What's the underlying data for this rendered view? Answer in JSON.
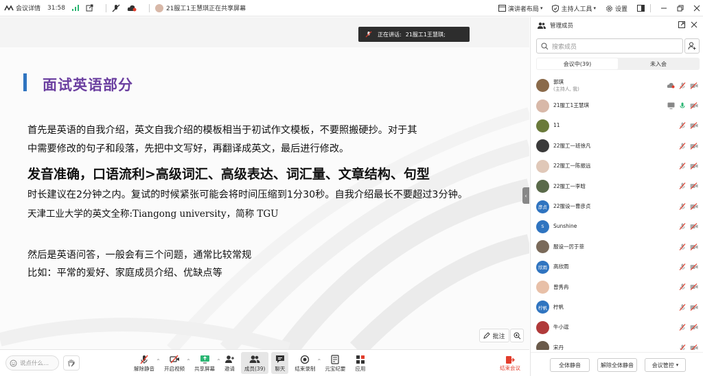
{
  "topbar": {
    "meeting_info": "会议详情",
    "duration": "31:58",
    "share_notice": "21服工1王慧琪正在共享屏幕",
    "layout_label": "演讲者布局",
    "host_tools": "主持人工具",
    "settings": "设置"
  },
  "speaker": {
    "label": "正在讲话:",
    "name": "21服工1王慧琪;"
  },
  "slide": {
    "title": "面试英语部分",
    "lines": [
      "首先是英语的自我介绍，英文自我介绍的模板相当于初试作文模板，不要照搬硬抄。对于其",
      "中需要修改的句子和段落，先把中文写好，再翻译成英文，最后进行修改。",
      "发音准确，口语流利>高级词汇、高级表达、词汇量、文章结构、句型",
      "时长建议在2分钟之内。复试的时候紧张可能会将时间压缩到1分30秒。自我介绍最长不要超过3分钟。",
      "天津工业大学的英文全称:Tiangong university，简称 TGU",
      "然后是英语问答，一般会有三个问题，通常比较常规",
      "比如：平常的爱好、家庭成员介绍、优缺点等"
    ]
  },
  "annotate_label": "批注",
  "bottombar": {
    "chat_placeholder": "说点什么...",
    "tools": [
      {
        "label": "解除静音",
        "icon": "mic-off-icon"
      },
      {
        "label": "开启视频",
        "icon": "camera-off-icon"
      },
      {
        "label": "共享屏幕",
        "icon": "share-screen-icon"
      },
      {
        "label": "邀请",
        "icon": "invite-icon"
      },
      {
        "label": "成员(39)",
        "icon": "members-icon"
      },
      {
        "label": "聊天",
        "icon": "chat-icon"
      },
      {
        "label": "结束录制",
        "icon": "record-icon"
      },
      {
        "label": "元宝纪要",
        "icon": "notes-icon"
      },
      {
        "label": "应用",
        "icon": "apps-icon"
      }
    ],
    "end_label": "结束会议"
  },
  "panel": {
    "title": "管理成员",
    "search_placeholder": "搜索成员",
    "tabs": [
      "会议中(39)",
      "未入会"
    ],
    "members": [
      {
        "name": "郭琪",
        "sub": "(主持人, 我)",
        "avatar_text": "",
        "color": "#8a6a4a",
        "cloud": true
      },
      {
        "name": "21服工1王慧琪",
        "sub": "",
        "avatar_text": "",
        "color": "#d8b8a8",
        "screen": true,
        "speaking": true
      },
      {
        "name": "11",
        "sub": "",
        "avatar_text": "",
        "color": "#6a7a3a"
      },
      {
        "name": "22服工一班徐凡",
        "sub": "",
        "avatar_text": "",
        "color": "#3a3a3a"
      },
      {
        "name": "22服工一陈振远",
        "sub": "",
        "avatar_text": "",
        "color": "#e0c8b8"
      },
      {
        "name": "22服工一李晗",
        "sub": "",
        "avatar_text": "",
        "color": "#5a6a4a"
      },
      {
        "name": "22服设一曹彦贞",
        "sub": "",
        "avatar_text": "彦贞",
        "color": "#2f74c0"
      },
      {
        "name": "Sunshine",
        "sub": "",
        "avatar_text": "S",
        "color": "#2f74c0"
      },
      {
        "name": "服设一厉于菲",
        "sub": "",
        "avatar_text": "",
        "color": "#7a6a5a"
      },
      {
        "name": "高欣雨",
        "sub": "",
        "avatar_text": "欣雨",
        "color": "#2f74c0"
      },
      {
        "name": "曾秀冉",
        "sub": "",
        "avatar_text": "",
        "color": "#e8c0a8"
      },
      {
        "name": "柠帆",
        "sub": "",
        "avatar_text": "柠帆",
        "color": "#2f74c0"
      },
      {
        "name": "牛小逗",
        "sub": "",
        "avatar_text": "",
        "color": "#b03a3a"
      },
      {
        "name": "宋丹",
        "sub": "",
        "avatar_text": "",
        "color": "#6a5a4a"
      }
    ],
    "footer": {
      "mute_all": "全体静音",
      "unmute_all": "解除全体静音",
      "control": "会议管控"
    }
  },
  "colors": {
    "accent": "#2f74c0",
    "title_purple": "#6b3fa0",
    "danger": "#e23d2c"
  }
}
